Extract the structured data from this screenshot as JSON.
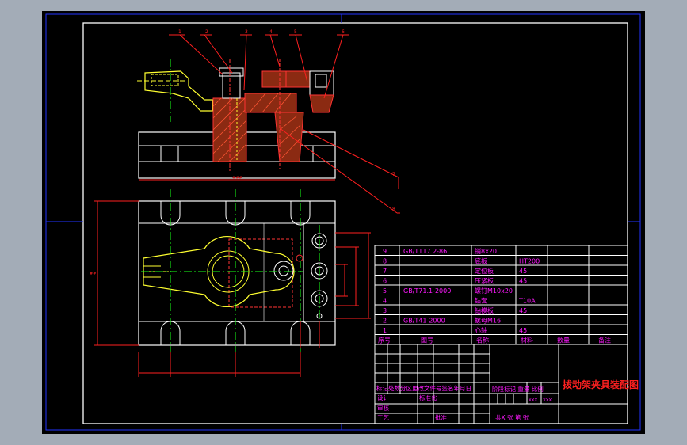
{
  "parts_list": {
    "rows": [
      {
        "no": "9",
        "code": "GB/T117.2-86",
        "name": "销8x20",
        "material": "",
        "qty": "",
        "note": ""
      },
      {
        "no": "8",
        "code": "",
        "name": "底板",
        "material": "HT200",
        "qty": "",
        "note": ""
      },
      {
        "no": "7",
        "code": "",
        "name": "定位板",
        "material": "45",
        "qty": "",
        "note": ""
      },
      {
        "no": "6",
        "code": "",
        "name": "压紧板",
        "material": "45",
        "qty": "",
        "note": ""
      },
      {
        "no": "5",
        "code": "GB/T71.1-2000",
        "name": "螺钉M10x20",
        "material": "",
        "qty": "",
        "note": ""
      },
      {
        "no": "4",
        "code": "",
        "name": "钻套",
        "material": "T10A",
        "qty": "",
        "note": ""
      },
      {
        "no": "3",
        "code": "",
        "name": "钻模板",
        "material": "45",
        "qty": "",
        "note": ""
      },
      {
        "no": "2",
        "code": "GB/T41-2000",
        "name": "螺母M16",
        "material": "",
        "qty": "",
        "note": ""
      },
      {
        "no": "1",
        "code": "",
        "name": "心轴",
        "material": "45",
        "qty": "",
        "note": ""
      }
    ],
    "header": {
      "no": "序号",
      "code": "图号",
      "name": "名称",
      "material": "材料",
      "qty": "数量",
      "note": "备注"
    }
  },
  "title_block": {
    "title": "拨动架夹具装配图",
    "revision_row": "标记处数分区更改文件号签名年月日",
    "design_label": "设计",
    "standardize_label": "标准化",
    "stage_labels": "阶段标记  重量  比例",
    "scale_left": "XXX",
    "scale_right": "XXX",
    "review_label": "审核",
    "process_label": "工艺",
    "approve_label": "批准",
    "sheets": "共X  张 第  张"
  },
  "dimension_labels": {
    "top_width": "###",
    "left_height": "##"
  },
  "colors": {
    "background": "#000000",
    "frame": "#ffffff",
    "screen_border": "#0000ff",
    "table_text": "#ff19ff",
    "dimension": "#ff2020",
    "centerline": "#19ff19",
    "workpiece": "#ffff30"
  }
}
